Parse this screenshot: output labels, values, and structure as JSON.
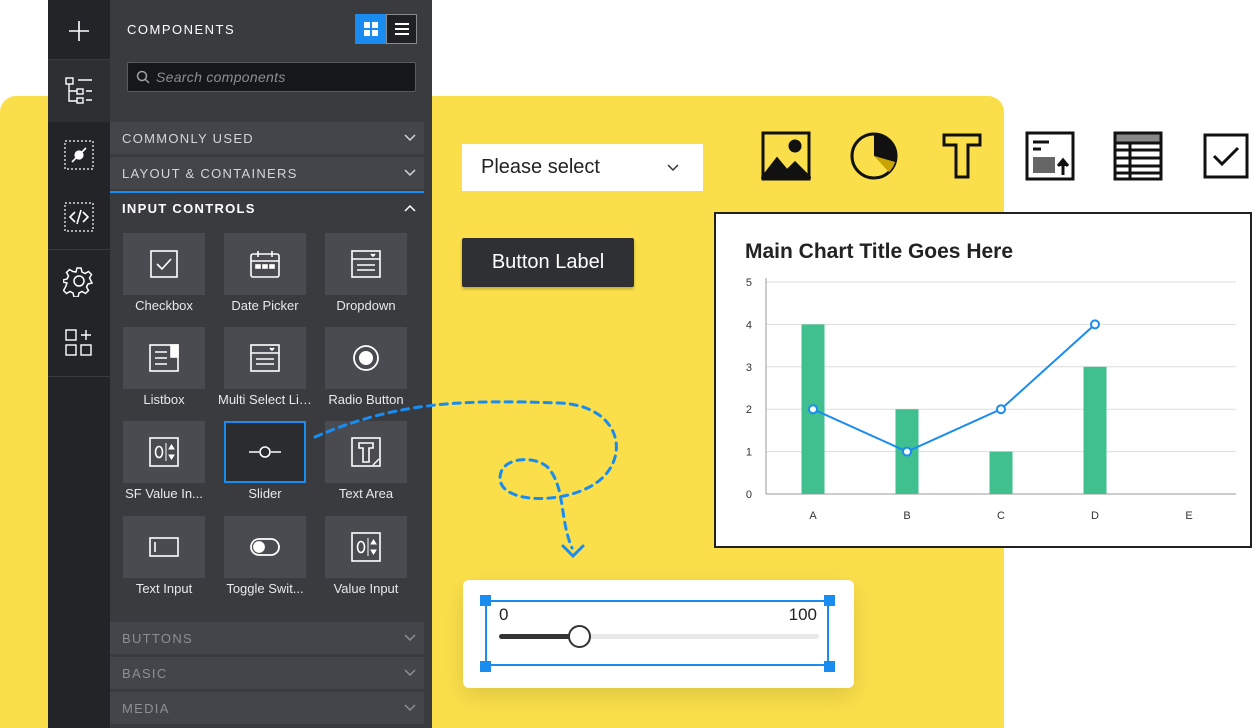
{
  "panel": {
    "title": "COMPONENTS",
    "search_placeholder": "Search components"
  },
  "rail": {
    "items": [
      "add-icon",
      "tree-icon",
      "plugin-icon",
      "code-icon",
      "gear-icon",
      "widgets-icon"
    ]
  },
  "sections": {
    "commonly_used": "COMMONLY USED",
    "layout": "LAYOUT & CONTAINERS",
    "input_controls": "INPUT CONTROLS",
    "buttons": "BUTTONS",
    "basic": "BASIC",
    "media": "MEDIA"
  },
  "tiles": [
    {
      "label": "Checkbox"
    },
    {
      "label": "Date Picker"
    },
    {
      "label": "Dropdown"
    },
    {
      "label": "Listbox"
    },
    {
      "label": "Multi Select Listbox"
    },
    {
      "label": "Radio Button"
    },
    {
      "label": "SF Value Input"
    },
    {
      "label": "Slider"
    },
    {
      "label": "Text Area"
    },
    {
      "label": "Text Input"
    },
    {
      "label": "Toggle Switch"
    },
    {
      "label": "Value Input"
    }
  ],
  "canvas": {
    "select_text": "Please select",
    "button_label": "Button Label",
    "toolbar_icons": [
      "image-icon",
      "pie-chart-icon",
      "text-icon",
      "file-upload-icon",
      "table-icon",
      "checkbox-icon"
    ]
  },
  "slider": {
    "min_label": "0",
    "max_label": "100",
    "value": 25
  },
  "colors": {
    "accent": "#1a8cf0",
    "yellow": "#fbdf4a",
    "bar": "#40bf8f",
    "line": "#1a8cf0"
  },
  "chart_data": {
    "type": "bar",
    "title": "Main Chart Title Goes Here",
    "categories": [
      "A",
      "B",
      "C",
      "D",
      "E"
    ],
    "series": [
      {
        "type": "bar",
        "values": [
          4,
          2,
          1,
          3,
          null
        ]
      },
      {
        "type": "line",
        "values": [
          2,
          1,
          2,
          4,
          null
        ]
      }
    ],
    "ylim": [
      0,
      5
    ],
    "yticks": [
      "0",
      "1",
      "2",
      "3",
      "4",
      "5"
    ],
    "grid": true
  }
}
